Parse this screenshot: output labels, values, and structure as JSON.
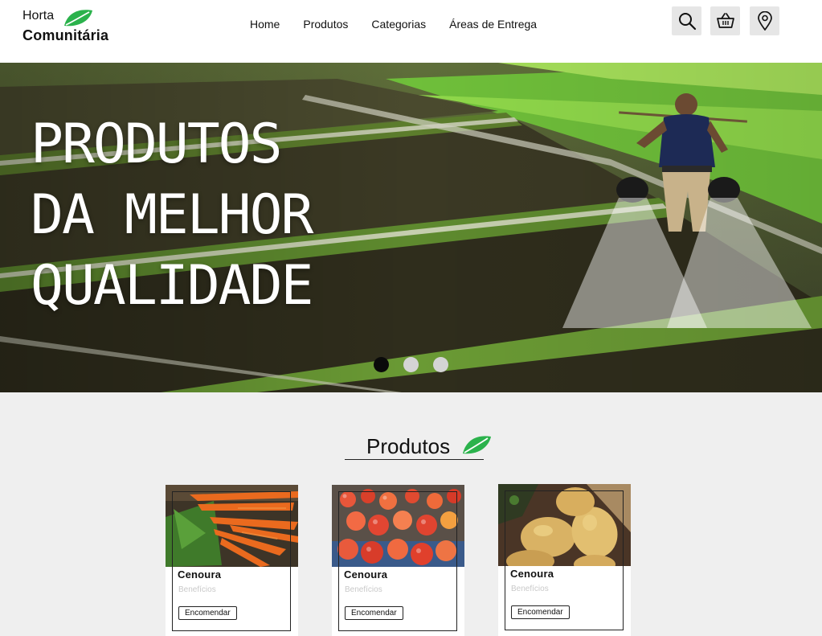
{
  "logo": {
    "line1": "Horta",
    "line2": "Comunitária",
    "icon": "leaf-icon",
    "accent_color": "#2bb24c"
  },
  "nav": {
    "items": [
      "Home",
      "Produtos",
      "Categorias",
      "Áreas de Entrega"
    ]
  },
  "header_icons": [
    "search-icon",
    "basket-icon",
    "location-pin-icon"
  ],
  "hero": {
    "title_lines": [
      "PRODUTOS",
      "DA MELHOR",
      "QUALIDADE"
    ],
    "carousel": {
      "slide_count": 3,
      "active_index": 0
    }
  },
  "products_section": {
    "title": "Produtos",
    "icon": "leaf-icon"
  },
  "products": [
    {
      "name": "Cenoura",
      "subtitle": "Benefícios",
      "button": "Encomendar",
      "image": "carrots-photo"
    },
    {
      "name": "Cenoura",
      "subtitle": "Benefícios",
      "button": "Encomendar",
      "image": "tomatoes-photo"
    },
    {
      "name": "Cenoura",
      "subtitle": "Benefícios",
      "button": "Encomendar",
      "image": "potatoes-photo"
    }
  ]
}
